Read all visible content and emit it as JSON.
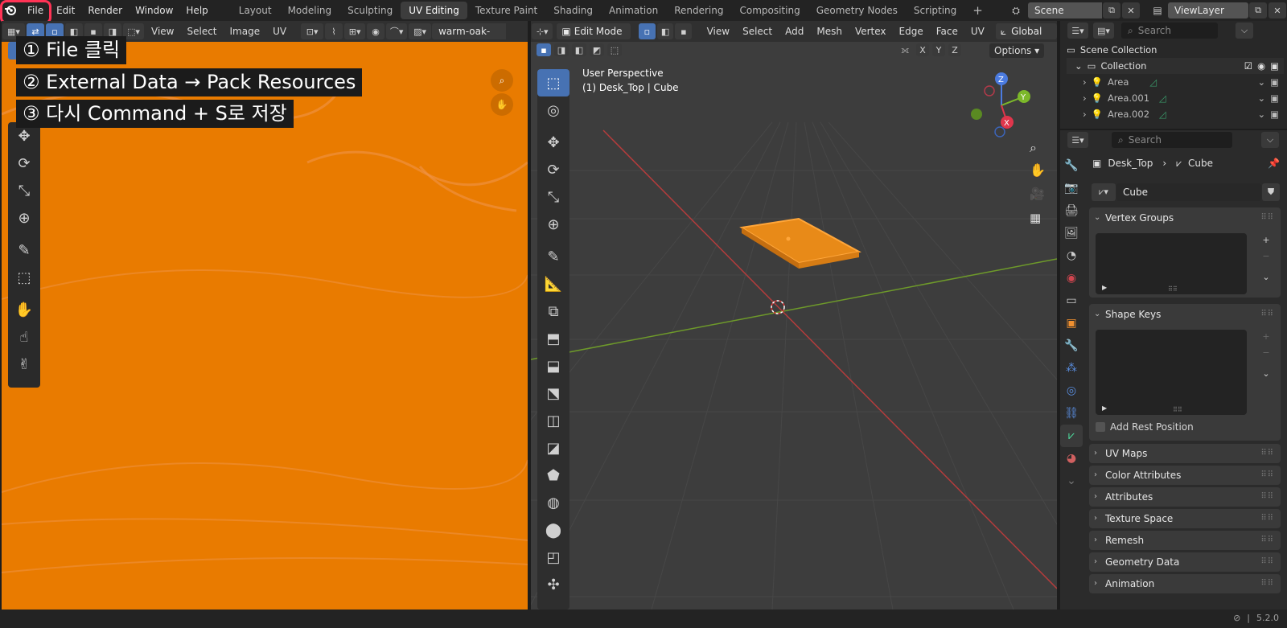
{
  "app": {
    "menus": [
      "File",
      "Edit",
      "Render",
      "Window",
      "Help"
    ],
    "workspaces": [
      "Layout",
      "Modeling",
      "Sculpting",
      "UV Editing",
      "Texture Paint",
      "Shading",
      "Animation",
      "Rendering",
      "Compositing",
      "Geometry Nodes",
      "Scripting"
    ],
    "active_workspace": "UV Editing",
    "scene": "Scene",
    "view_layer": "ViewLayer",
    "version": "5.2.0"
  },
  "annotations": {
    "step1": "① File 클릭",
    "step2": "② External Data → Pack Resources",
    "step3": "③ 다시 Command + S로 저장"
  },
  "uv_editor": {
    "menus": [
      "View",
      "Select",
      "Image",
      "UV"
    ],
    "image_name": "warm-oak-gra"
  },
  "viewport": {
    "mode": "Edit Mode",
    "menus": [
      "View",
      "Select",
      "Add",
      "Mesh",
      "Vertex",
      "Edge",
      "Face",
      "UV"
    ],
    "orientation": "Global",
    "options_label": "Options",
    "perspective": "User Perspective",
    "object_info": "(1) Desk_Top | Cube",
    "axes": {
      "x": "X",
      "y": "Y",
      "z": "Z"
    }
  },
  "outliner": {
    "search_placeholder": "Search",
    "scene_collection": "Scene Collection",
    "collection": "Collection",
    "items": [
      "Area",
      "Area.001",
      "Area.002"
    ]
  },
  "properties": {
    "search_placeholder": "Search",
    "breadcrumb_object": "Desk_Top",
    "breadcrumb_data": "Cube",
    "mesh_name": "Cube",
    "panels": {
      "vertex_groups": "Vertex Groups",
      "shape_keys": "Shape Keys",
      "add_rest_position": "Add Rest Position",
      "uv_maps": "UV Maps",
      "color_attributes": "Color Attributes",
      "attributes": "Attributes",
      "texture_space": "Texture Space",
      "remesh": "Remesh",
      "geometry_data": "Geometry Data",
      "animation": "Animation"
    }
  },
  "colors": {
    "accent": "#4772b3",
    "highlight_box": "#ff3355",
    "uv_background": "#e97b00",
    "selection_orange": "#f0a030"
  }
}
